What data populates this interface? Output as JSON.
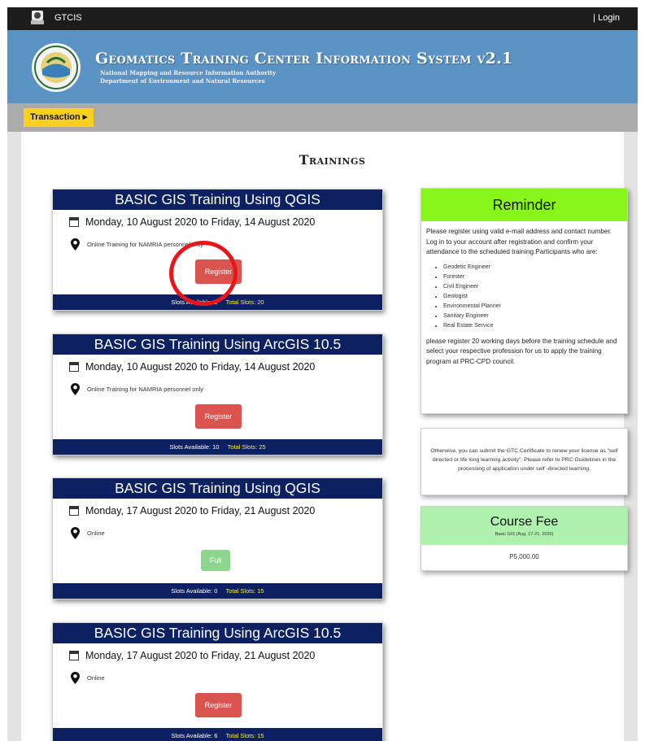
{
  "topbar": {
    "app_name": "GTCIS",
    "login_label": "| Login"
  },
  "banner": {
    "title": "Geomatics Training Center Information System v2.1",
    "subtitle1": "National Mapping and Resource Information Authority",
    "subtitle2": "Department of Environment and Natural Resources"
  },
  "navbar": {
    "transaction_label": "Transaction ▸"
  },
  "page_title": "Trainings",
  "trainings": [
    {
      "title": "BASIC GIS Training Using QGIS",
      "date": "Monday, 10 August 2020 to Friday, 14 August 2020",
      "location": "Online Training for NAMRIA personnel only",
      "button": "Register",
      "slots_available": "Slots Available: 1",
      "total_slots": "Total Slots: 20"
    },
    {
      "title": "BASIC GIS Training Using ArcGIS 10.5",
      "date": "Monday, 10 August 2020 to Friday, 14 August 2020",
      "location": "Online Training for NAMRIA personnel only",
      "button": "Register",
      "slots_available": "Slots Available: 10",
      "total_slots": "Total Slots: 25"
    },
    {
      "title": "BASIC GIS Training Using QGIS",
      "date": "Monday, 17 August 2020 to Friday, 21 August 2020",
      "location": "Online",
      "button": "Full",
      "slots_available": "Slots Available: 0",
      "total_slots": "Total Slots: 15"
    },
    {
      "title": "BASIC GIS Training Using ArcGIS 10.5",
      "date": "Monday, 17 August 2020 to Friday, 21 August 2020",
      "location": "Online",
      "button": "Register",
      "slots_available": "Slots Available: 6",
      "total_slots": "Total Slots: 15"
    }
  ],
  "reminder": {
    "title": "Reminder",
    "text1": "Please register using valid e-mail address and contact number. Log in to your account after registration and confirm your attendance to the scheduled training.Participants who are:",
    "professions": [
      "Geodetic Engineer",
      "Forester",
      "Civil Engineer",
      "Geologist",
      "Environmental Planner",
      "Sanitary Engineer",
      "Real Estate Service"
    ],
    "text2": "please register 20 working days before the training schedule and select your respective profession for us to apply the training program at PRC-CPD council."
  },
  "note": "Otherwise, you can submit the GTC Certificate to renew your license as \"self directed or life long learning activity\". Please refer to PRC Guidelines in the processing of application under self -directed learning.",
  "course_fee": {
    "title": "Course Fee",
    "subtitle": "Basic GIS (Aug. 17-21, 2020)",
    "price": "P5,000.00"
  },
  "colors": {
    "topbar": "#1c1c1c",
    "banner": "#5b93c4",
    "navbar": "#ababab",
    "transaction": "#fbd11f",
    "card_header": "#0d2061",
    "register_button": "#d9534f",
    "full_button": "#8ed68e",
    "reminder_header": "#88f51b",
    "fee_header": "#aef2ae",
    "highlight_ring": "#e8161b",
    "total_slots_text": "#ffeb3b"
  }
}
